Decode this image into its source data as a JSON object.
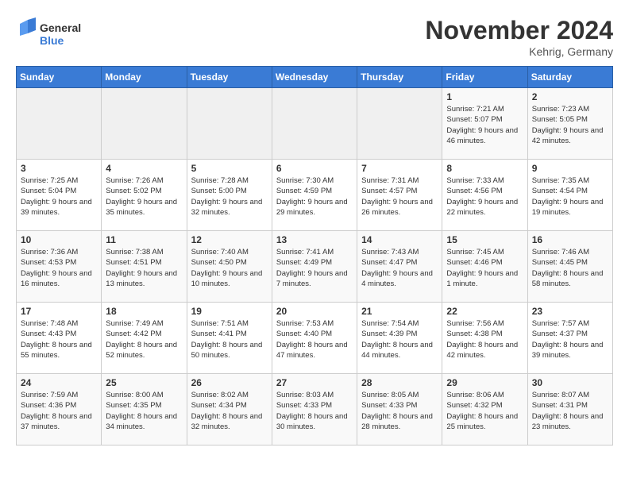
{
  "header": {
    "logo_general": "General",
    "logo_blue": "Blue",
    "month_title": "November 2024",
    "location": "Kehrig, Germany"
  },
  "weekdays": [
    "Sunday",
    "Monday",
    "Tuesday",
    "Wednesday",
    "Thursday",
    "Friday",
    "Saturday"
  ],
  "weeks": [
    [
      {
        "day": "",
        "sunrise": "",
        "sunset": "",
        "daylight": ""
      },
      {
        "day": "",
        "sunrise": "",
        "sunset": "",
        "daylight": ""
      },
      {
        "day": "",
        "sunrise": "",
        "sunset": "",
        "daylight": ""
      },
      {
        "day": "",
        "sunrise": "",
        "sunset": "",
        "daylight": ""
      },
      {
        "day": "",
        "sunrise": "",
        "sunset": "",
        "daylight": ""
      },
      {
        "day": "1",
        "sunrise": "Sunrise: 7:21 AM",
        "sunset": "Sunset: 5:07 PM",
        "daylight": "Daylight: 9 hours and 46 minutes."
      },
      {
        "day": "2",
        "sunrise": "Sunrise: 7:23 AM",
        "sunset": "Sunset: 5:05 PM",
        "daylight": "Daylight: 9 hours and 42 minutes."
      }
    ],
    [
      {
        "day": "3",
        "sunrise": "Sunrise: 7:25 AM",
        "sunset": "Sunset: 5:04 PM",
        "daylight": "Daylight: 9 hours and 39 minutes."
      },
      {
        "day": "4",
        "sunrise": "Sunrise: 7:26 AM",
        "sunset": "Sunset: 5:02 PM",
        "daylight": "Daylight: 9 hours and 35 minutes."
      },
      {
        "day": "5",
        "sunrise": "Sunrise: 7:28 AM",
        "sunset": "Sunset: 5:00 PM",
        "daylight": "Daylight: 9 hours and 32 minutes."
      },
      {
        "day": "6",
        "sunrise": "Sunrise: 7:30 AM",
        "sunset": "Sunset: 4:59 PM",
        "daylight": "Daylight: 9 hours and 29 minutes."
      },
      {
        "day": "7",
        "sunrise": "Sunrise: 7:31 AM",
        "sunset": "Sunset: 4:57 PM",
        "daylight": "Daylight: 9 hours and 26 minutes."
      },
      {
        "day": "8",
        "sunrise": "Sunrise: 7:33 AM",
        "sunset": "Sunset: 4:56 PM",
        "daylight": "Daylight: 9 hours and 22 minutes."
      },
      {
        "day": "9",
        "sunrise": "Sunrise: 7:35 AM",
        "sunset": "Sunset: 4:54 PM",
        "daylight": "Daylight: 9 hours and 19 minutes."
      }
    ],
    [
      {
        "day": "10",
        "sunrise": "Sunrise: 7:36 AM",
        "sunset": "Sunset: 4:53 PM",
        "daylight": "Daylight: 9 hours and 16 minutes."
      },
      {
        "day": "11",
        "sunrise": "Sunrise: 7:38 AM",
        "sunset": "Sunset: 4:51 PM",
        "daylight": "Daylight: 9 hours and 13 minutes."
      },
      {
        "day": "12",
        "sunrise": "Sunrise: 7:40 AM",
        "sunset": "Sunset: 4:50 PM",
        "daylight": "Daylight: 9 hours and 10 minutes."
      },
      {
        "day": "13",
        "sunrise": "Sunrise: 7:41 AM",
        "sunset": "Sunset: 4:49 PM",
        "daylight": "Daylight: 9 hours and 7 minutes."
      },
      {
        "day": "14",
        "sunrise": "Sunrise: 7:43 AM",
        "sunset": "Sunset: 4:47 PM",
        "daylight": "Daylight: 9 hours and 4 minutes."
      },
      {
        "day": "15",
        "sunrise": "Sunrise: 7:45 AM",
        "sunset": "Sunset: 4:46 PM",
        "daylight": "Daylight: 9 hours and 1 minute."
      },
      {
        "day": "16",
        "sunrise": "Sunrise: 7:46 AM",
        "sunset": "Sunset: 4:45 PM",
        "daylight": "Daylight: 8 hours and 58 minutes."
      }
    ],
    [
      {
        "day": "17",
        "sunrise": "Sunrise: 7:48 AM",
        "sunset": "Sunset: 4:43 PM",
        "daylight": "Daylight: 8 hours and 55 minutes."
      },
      {
        "day": "18",
        "sunrise": "Sunrise: 7:49 AM",
        "sunset": "Sunset: 4:42 PM",
        "daylight": "Daylight: 8 hours and 52 minutes."
      },
      {
        "day": "19",
        "sunrise": "Sunrise: 7:51 AM",
        "sunset": "Sunset: 4:41 PM",
        "daylight": "Daylight: 8 hours and 50 minutes."
      },
      {
        "day": "20",
        "sunrise": "Sunrise: 7:53 AM",
        "sunset": "Sunset: 4:40 PM",
        "daylight": "Daylight: 8 hours and 47 minutes."
      },
      {
        "day": "21",
        "sunrise": "Sunrise: 7:54 AM",
        "sunset": "Sunset: 4:39 PM",
        "daylight": "Daylight: 8 hours and 44 minutes."
      },
      {
        "day": "22",
        "sunrise": "Sunrise: 7:56 AM",
        "sunset": "Sunset: 4:38 PM",
        "daylight": "Daylight: 8 hours and 42 minutes."
      },
      {
        "day": "23",
        "sunrise": "Sunrise: 7:57 AM",
        "sunset": "Sunset: 4:37 PM",
        "daylight": "Daylight: 8 hours and 39 minutes."
      }
    ],
    [
      {
        "day": "24",
        "sunrise": "Sunrise: 7:59 AM",
        "sunset": "Sunset: 4:36 PM",
        "daylight": "Daylight: 8 hours and 37 minutes."
      },
      {
        "day": "25",
        "sunrise": "Sunrise: 8:00 AM",
        "sunset": "Sunset: 4:35 PM",
        "daylight": "Daylight: 8 hours and 34 minutes."
      },
      {
        "day": "26",
        "sunrise": "Sunrise: 8:02 AM",
        "sunset": "Sunset: 4:34 PM",
        "daylight": "Daylight: 8 hours and 32 minutes."
      },
      {
        "day": "27",
        "sunrise": "Sunrise: 8:03 AM",
        "sunset": "Sunset: 4:33 PM",
        "daylight": "Daylight: 8 hours and 30 minutes."
      },
      {
        "day": "28",
        "sunrise": "Sunrise: 8:05 AM",
        "sunset": "Sunset: 4:33 PM",
        "daylight": "Daylight: 8 hours and 28 minutes."
      },
      {
        "day": "29",
        "sunrise": "Sunrise: 8:06 AM",
        "sunset": "Sunset: 4:32 PM",
        "daylight": "Daylight: 8 hours and 25 minutes."
      },
      {
        "day": "30",
        "sunrise": "Sunrise: 8:07 AM",
        "sunset": "Sunset: 4:31 PM",
        "daylight": "Daylight: 8 hours and 23 minutes."
      }
    ]
  ]
}
